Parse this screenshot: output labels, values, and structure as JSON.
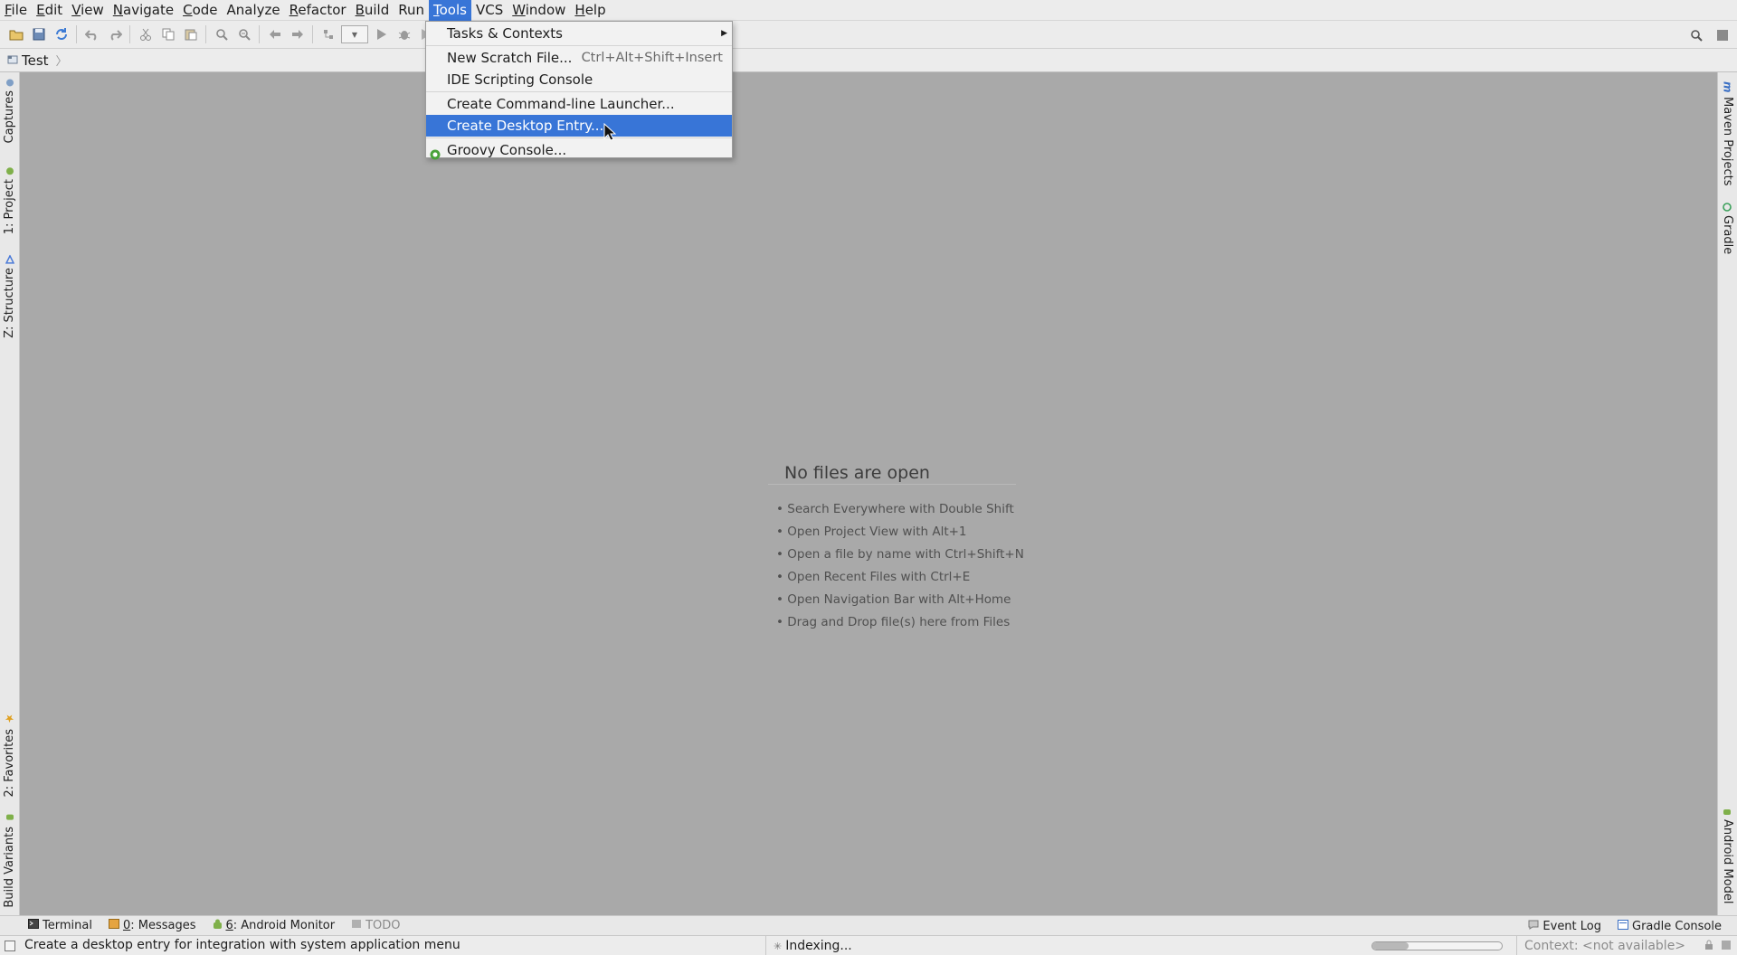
{
  "menubar": {
    "items": [
      {
        "label": "File",
        "mnemonic": "F",
        "rest": "ile"
      },
      {
        "label": "Edit",
        "mnemonic": "E",
        "rest": "dit"
      },
      {
        "label": "View",
        "mnemonic": "V",
        "rest": "iew"
      },
      {
        "label": "Navigate",
        "mnemonic": "N",
        "rest": "avigate"
      },
      {
        "label": "Code",
        "mnemonic": "C",
        "rest": "ode"
      },
      {
        "label": "Analyze",
        "mnemonic": "",
        "rest": "Analyze"
      },
      {
        "label": "Refactor",
        "mnemonic": "R",
        "rest": "efactor"
      },
      {
        "label": "Build",
        "mnemonic": "B",
        "rest": "uild"
      },
      {
        "label": "Run",
        "mnemonic": "",
        "rest": "Run"
      },
      {
        "label": "Tools",
        "mnemonic": "T",
        "rest": "ools"
      },
      {
        "label": "VCS",
        "mnemonic": "",
        "rest": "VCS"
      },
      {
        "label": "Window",
        "mnemonic": "W",
        "rest": "indow"
      },
      {
        "label": "Help",
        "mnemonic": "H",
        "rest": "elp"
      }
    ]
  },
  "toolbar": {
    "icons": [
      "open-folder-icon",
      "save-icon",
      "sync-icon",
      "undo-icon",
      "redo-icon",
      "cut-icon",
      "copy-icon",
      "paste-icon",
      "find-icon",
      "replace-icon",
      "back-icon",
      "forward-icon",
      "make-project-icon",
      "run-config-combo",
      "run-icon",
      "debug-icon",
      "coverage-icon"
    ]
  },
  "navbar": {
    "breadcrumb": "Test"
  },
  "tools_menu": {
    "items": [
      {
        "label": "Tasks & Contexts",
        "shortcut": "",
        "submenu": true
      },
      {
        "label": "New Scratch File...",
        "shortcut": "Ctrl+Alt+Shift+Insert"
      },
      {
        "label": "IDE Scripting Console",
        "shortcut": ""
      },
      {
        "label": "Create Command-line Launcher...",
        "shortcut": ""
      },
      {
        "label": "Create Desktop Entry...",
        "shortcut": "",
        "highlighted": true
      },
      {
        "label": "Groovy Console...",
        "shortcut": ""
      }
    ]
  },
  "left_strip": {
    "captures": "Captures",
    "project": "1: Project",
    "structure": "Z: Structure",
    "favorites": "2: Favorites",
    "build_variants": "Build Variants"
  },
  "right_strip": {
    "maven": "Maven Projects",
    "gradle": "Gradle",
    "android_model": "Android Model"
  },
  "editor": {
    "empty_title": "No files are open",
    "hints": [
      "• Search Everywhere with Double Shift",
      "• Open Project View with Alt+1",
      "• Open a file by name with Ctrl+Shift+N",
      "• Open Recent Files with Ctrl+E",
      "• Open Navigation Bar with Alt+Home",
      "• Drag and Drop file(s) here from Files"
    ]
  },
  "bottom_bar": {
    "terminal": "Terminal",
    "messages_num": "0",
    "messages_rest": ": Messages",
    "android_num": "6",
    "android_rest": ": Android Monitor",
    "todo": "TODO",
    "event_log": "Event Log",
    "gradle_console": "Gradle Console"
  },
  "status_bar": {
    "message": "Create a desktop entry for integration with system application menu",
    "indexing": "Indexing...",
    "progress_fraction": 0.28,
    "context": "Context: <not available>"
  },
  "colors": {
    "accent": "#3875d7",
    "editor_bg": "#a9a9a9",
    "chrome_bg": "#ececec"
  }
}
